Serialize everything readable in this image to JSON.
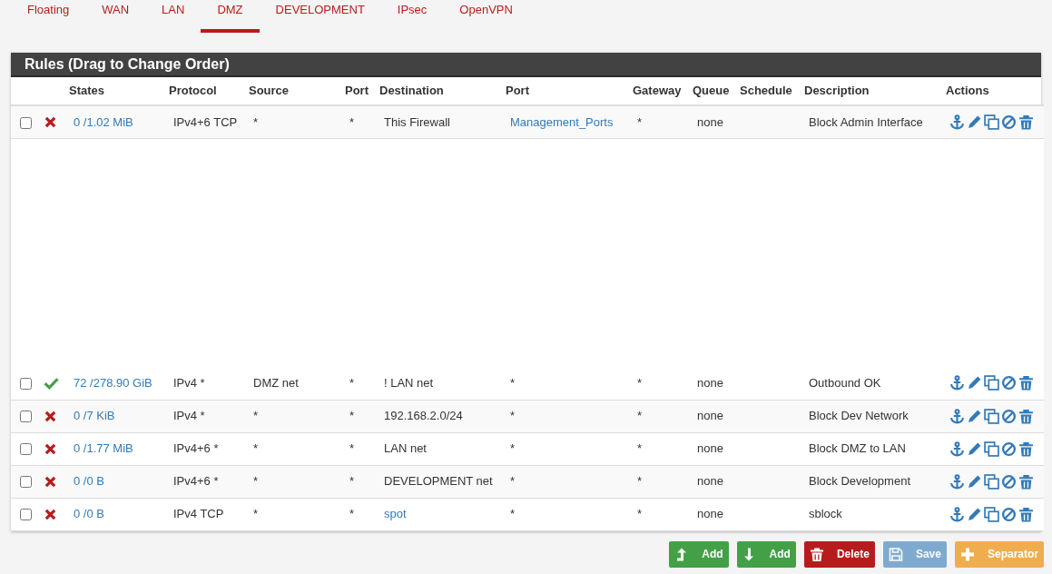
{
  "tabs": [
    {
      "label": "Floating",
      "selected": false
    },
    {
      "label": "WAN",
      "selected": false
    },
    {
      "label": "LAN",
      "selected": false
    },
    {
      "label": "DMZ",
      "selected": true
    },
    {
      "label": "DEVELOPMENT",
      "selected": false
    },
    {
      "label": "IPsec",
      "selected": false
    },
    {
      "label": "OpenVPN",
      "selected": false
    }
  ],
  "panel": {
    "title": "Rules (Drag to Change Order)"
  },
  "columns": [
    "States",
    "Protocol",
    "Source",
    "Port",
    "Destination",
    "Port",
    "Gateway",
    "Queue",
    "Schedule",
    "Description",
    "Actions"
  ],
  "rows": [
    {
      "checked": false,
      "kind": "block",
      "states": "0 /1.02 MiB",
      "protocol": "IPv4+6 TCP",
      "source": "*",
      "source_port": "*",
      "destination": "This Firewall",
      "destination_link": false,
      "port": "Management_Ports",
      "port_link": true,
      "gateway": "*",
      "queue": "none",
      "schedule": "",
      "description": "Block Admin Interface"
    },
    {
      "checked": false,
      "kind": "pass",
      "states": "72 /278.90 GiB",
      "protocol": "IPv4 *",
      "source": "DMZ net",
      "source_port": "*",
      "destination": "! LAN net",
      "destination_link": false,
      "port": "*",
      "port_link": false,
      "gateway": "*",
      "queue": "none",
      "schedule": "",
      "description": "Outbound OK"
    },
    {
      "checked": false,
      "kind": "block",
      "states": "0 /7 KiB",
      "protocol": "IPv4 *",
      "source": "*",
      "source_port": "*",
      "destination": "192.168.2.0/24",
      "destination_link": false,
      "port": "*",
      "port_link": false,
      "gateway": "*",
      "queue": "none",
      "schedule": "",
      "description": "Block Dev Network"
    },
    {
      "checked": false,
      "kind": "block",
      "states": "0 /1.77 MiB",
      "protocol": "IPv4+6 *",
      "source": "*",
      "source_port": "*",
      "destination": "LAN net",
      "destination_link": false,
      "port": "*",
      "port_link": false,
      "gateway": "*",
      "queue": "none",
      "schedule": "",
      "description": "Block DMZ to LAN"
    },
    {
      "checked": false,
      "kind": "block",
      "states": "0 /0 B",
      "protocol": "IPv4+6 *",
      "source": "*",
      "source_port": "*",
      "destination": "DEVELOPMENT net",
      "destination_link": false,
      "port": "*",
      "port_link": false,
      "gateway": "*",
      "queue": "none",
      "schedule": "",
      "description": "Block Development"
    },
    {
      "checked": false,
      "kind": "block",
      "states": "0 /0 B",
      "protocol": "IPv4 TCP",
      "source": "*",
      "source_port": "*",
      "destination": "spot",
      "destination_link": true,
      "port": "*",
      "port_link": false,
      "gateway": "*",
      "queue": "none",
      "schedule": "",
      "description": "sblock"
    }
  ],
  "buttons": [
    {
      "kind": "add-top",
      "label": "Add",
      "disabled": false
    },
    {
      "kind": "add-bottom",
      "label": "Add",
      "disabled": false
    },
    {
      "kind": "delete",
      "label": "Delete",
      "disabled": false
    },
    {
      "kind": "save",
      "label": "Save",
      "disabled": true
    },
    {
      "kind": "separator",
      "label": "Separator",
      "disabled": false
    }
  ]
}
